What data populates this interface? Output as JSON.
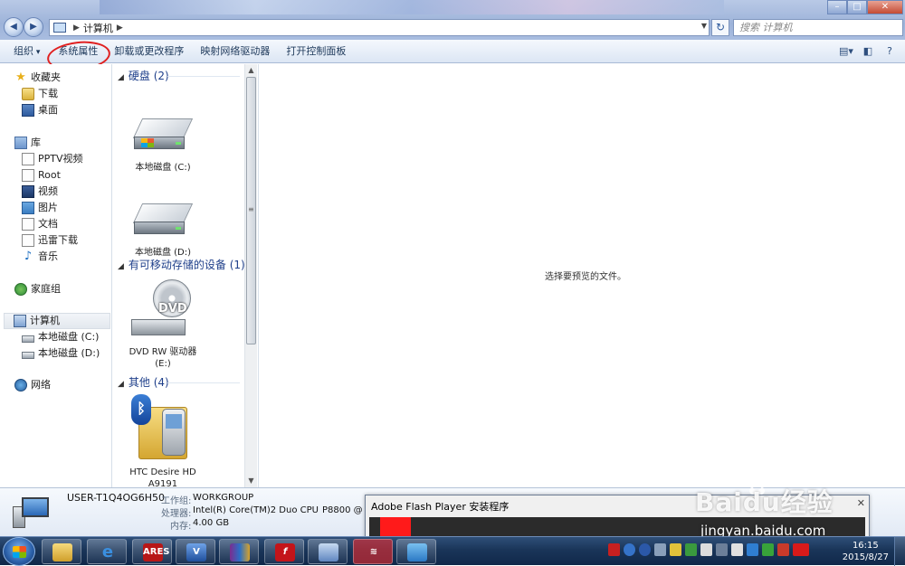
{
  "address": {
    "crumb": "计算机",
    "search_placeholder": "搜索 计算机"
  },
  "toolbar": {
    "organize": "组织",
    "system_properties": "系统属性",
    "uninstall": "卸载或更改程序",
    "map_drive": "映射网络驱动器",
    "control_panel": "打开控制面板"
  },
  "sidebar": {
    "favorites": "收藏夹",
    "downloads": "下载",
    "desktop": "桌面",
    "libraries": "库",
    "pptv": "PPTV视频",
    "root": "Root",
    "videos": "视频",
    "pictures": "图片",
    "documents": "文档",
    "xunlei": "迅雷下载",
    "music": "音乐",
    "homegroup": "家庭组",
    "computer": "计算机",
    "disk_c": "本地磁盘 (C:)",
    "disk_d": "本地磁盘 (D:)",
    "network": "网络"
  },
  "content": {
    "group_hdd": "硬盘 (2)",
    "drive_c": "本地磁盘 (C:)",
    "drive_d": "本地磁盘 (D:)",
    "group_removable": "有可移动存储的设备 (1)",
    "dvd_badge": "DVD",
    "dvd_label": "DVD RW 驱动器",
    "dvd_letter": "(E:)",
    "group_other": "其他 (4)",
    "htc_label": "HTC Desire HD",
    "htc_model": "A9191"
  },
  "preview": {
    "message": "选择要预览的文件。"
  },
  "details": {
    "name": "USER-T1Q4OG6H50",
    "workgroup_label": "工作组:",
    "workgroup": "WORKGROUP",
    "cpu_label": "处理器:",
    "cpu": "Intel(R) Core(TM)2 Duo CPU",
    "cpu_model": "P8800  @",
    "ram_label": "内存:",
    "ram": "4.00 GB"
  },
  "flash_dialog": {
    "title": "Adobe Flash Player 安装程序"
  },
  "watermark": {
    "brand": "Baidu经验",
    "url": "jingyan.baidu.com"
  },
  "taskbar": {
    "ares": "ARES",
    "time": "16:15",
    "date": "2015/8/27"
  },
  "colors": {
    "accent": "#1e3f8a",
    "annotation_circle": "#e02020",
    "flash_bar": "#ff1a1a"
  }
}
